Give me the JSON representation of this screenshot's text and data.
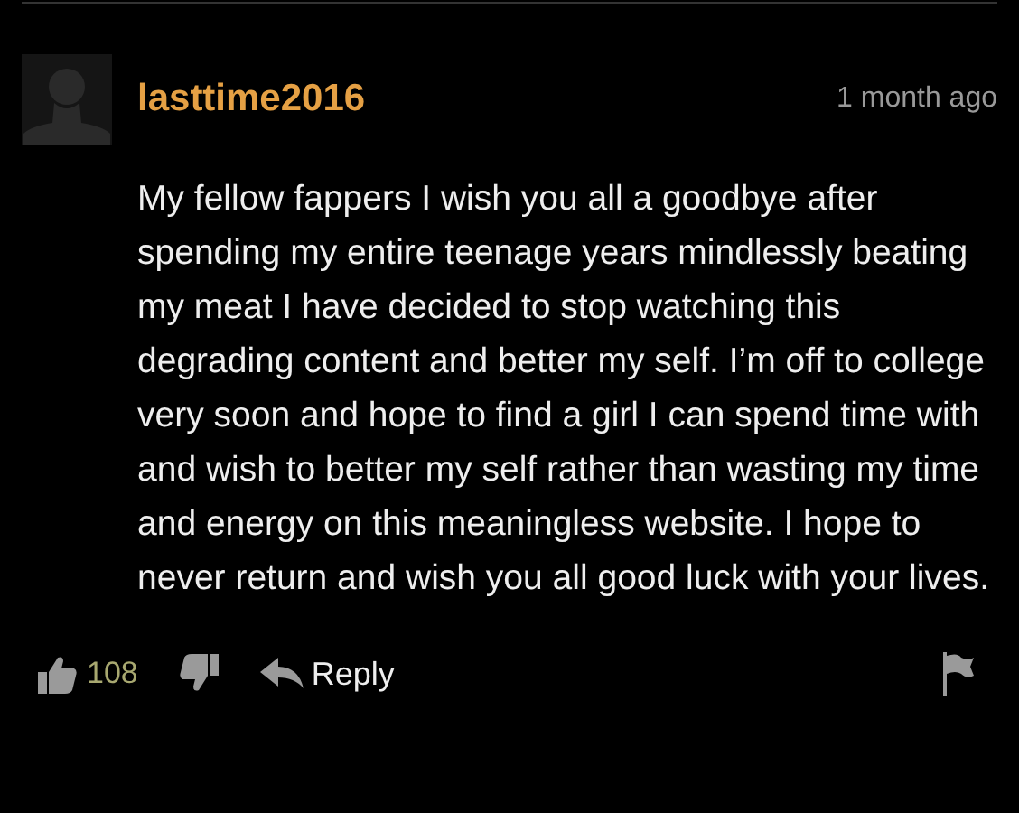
{
  "comment": {
    "username": "lasttime2016",
    "time": "1 month ago",
    "body": "My fellow fappers I wish you all a goodbye after spending my entire teenage years mindlessly beating my meat I have decided to stop watching this degrading content and better my self. I’m off to college very soon and hope to find a girl I can spend time with and wish to better my self rather than wasting my time and energy on this meaningless website. I hope to never return and wish you all good luck with your lives.",
    "likes": "108",
    "reply": "Reply"
  }
}
